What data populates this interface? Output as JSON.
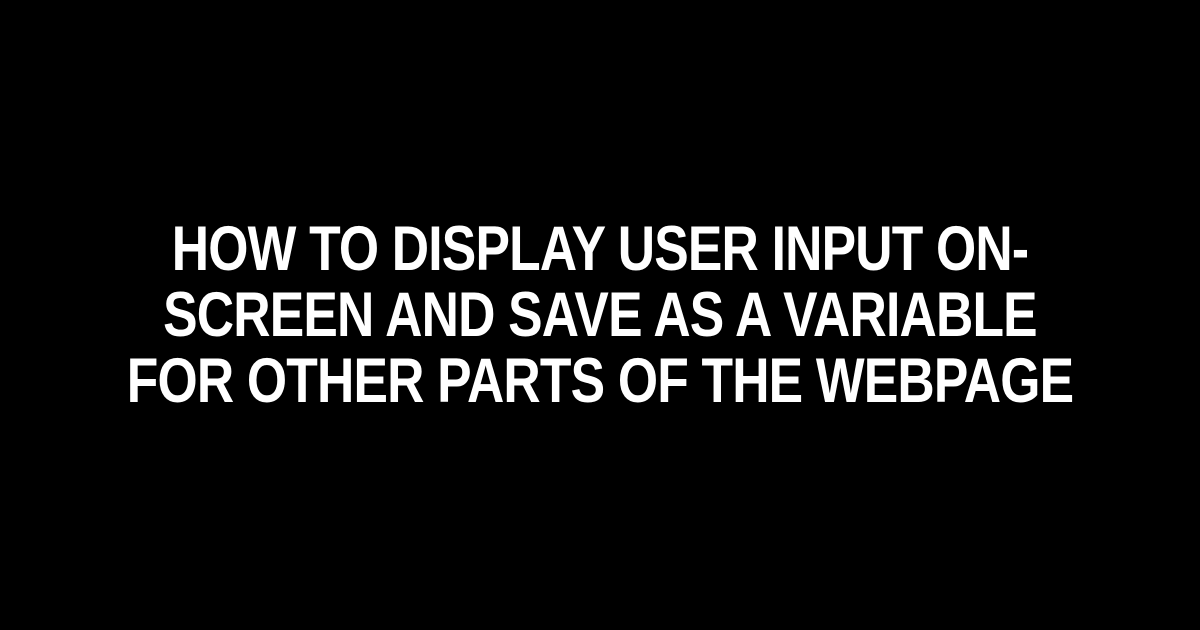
{
  "title": "How to Display User Input On-Screen and Save as a Variable for Other Parts of the Webpage"
}
